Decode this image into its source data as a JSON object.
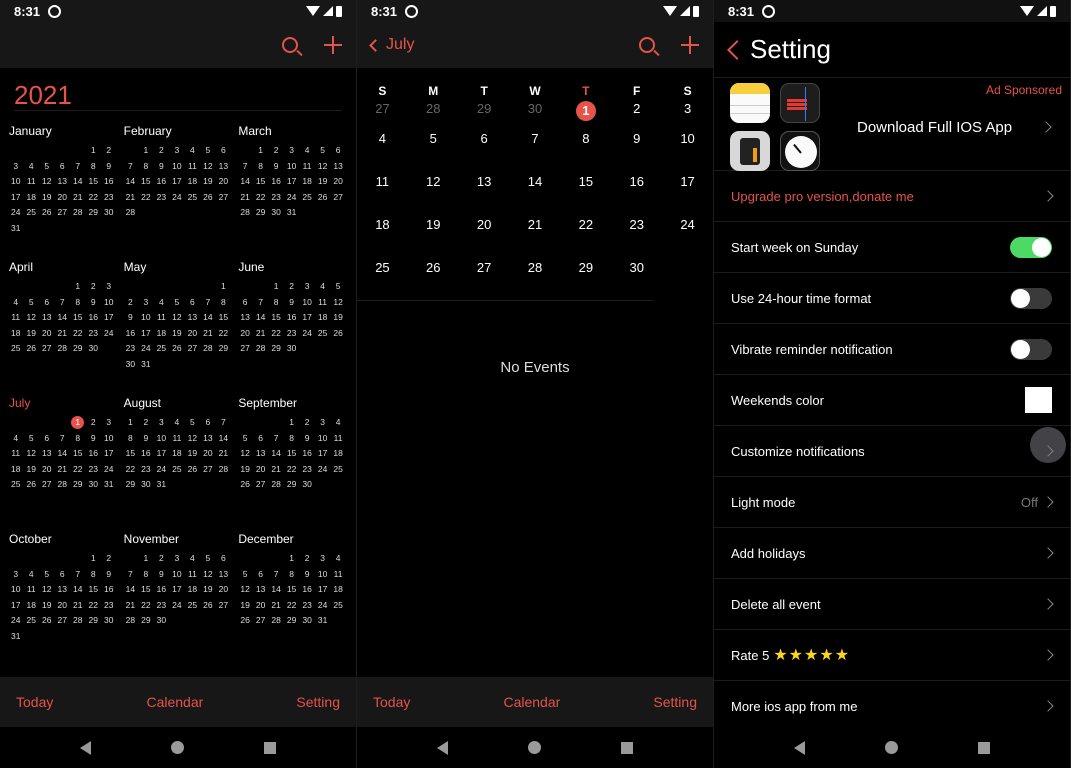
{
  "status_bar": {
    "time": "8:31"
  },
  "year_view": {
    "year": "2021",
    "months": [
      {
        "name": "January",
        "offset": 5,
        "days": 31
      },
      {
        "name": "February",
        "offset": 1,
        "days": 28
      },
      {
        "name": "March",
        "offset": 1,
        "days": 31
      },
      {
        "name": "April",
        "offset": 4,
        "days": 30
      },
      {
        "name": "May",
        "offset": 6,
        "days": 31
      },
      {
        "name": "June",
        "offset": 2,
        "days": 30
      },
      {
        "name": "July",
        "offset": 4,
        "days": 31,
        "current": true,
        "today": 1
      },
      {
        "name": "August",
        "offset": 0,
        "days": 31
      },
      {
        "name": "September",
        "offset": 3,
        "days": 30
      },
      {
        "name": "October",
        "offset": 5,
        "days": 31
      },
      {
        "name": "November",
        "offset": 1,
        "days": 30
      },
      {
        "name": "December",
        "offset": 3,
        "days": 31
      }
    ]
  },
  "month_view": {
    "back_label": "July",
    "weekdays": [
      "S",
      "M",
      "T",
      "W",
      "T",
      "F",
      "S"
    ],
    "highlight_weekday_index": 4,
    "prev_month_days": [
      "27",
      "28",
      "29",
      "30"
    ],
    "days": [
      "1",
      "2",
      "3",
      "4",
      "5",
      "6",
      "7",
      "8",
      "9",
      "10",
      "11",
      "12",
      "13",
      "14",
      "15",
      "16",
      "17",
      "18",
      "19",
      "20",
      "21",
      "22",
      "23",
      "24",
      "25",
      "26",
      "27",
      "28",
      "29",
      "30"
    ],
    "today": "1",
    "empty_message": "No Events"
  },
  "tabbar": {
    "today": "Today",
    "calendar": "Calendar",
    "setting": "Setting"
  },
  "settings": {
    "title": "Setting",
    "ad": {
      "tag": "Ad Sponsored",
      "title": "Download Full IOS App"
    },
    "rows": [
      {
        "label": "Upgrade pro version,donate me",
        "type": "link",
        "accent": true
      },
      {
        "label": "Start week on Sunday",
        "type": "toggle",
        "on": true
      },
      {
        "label": "Use 24-hour time format",
        "type": "toggle",
        "on": false
      },
      {
        "label": "Vibrate reminder notification",
        "type": "toggle",
        "on": false
      },
      {
        "label": "Weekends color",
        "type": "color",
        "color": "#ffffff"
      },
      {
        "label": "Customize notifications",
        "type": "link"
      },
      {
        "label": "Light mode",
        "type": "value",
        "value": "Off"
      },
      {
        "label": "Add holidays",
        "type": "link"
      },
      {
        "label": "Delete all event",
        "type": "link"
      },
      {
        "label": "Rate 5",
        "type": "rating",
        "stars": 5
      },
      {
        "label": "More ios app from me",
        "type": "link"
      }
    ]
  },
  "colors": {
    "accent": "#e5534b",
    "toggle_on": "#4cd964",
    "star": "#f9d71c"
  }
}
